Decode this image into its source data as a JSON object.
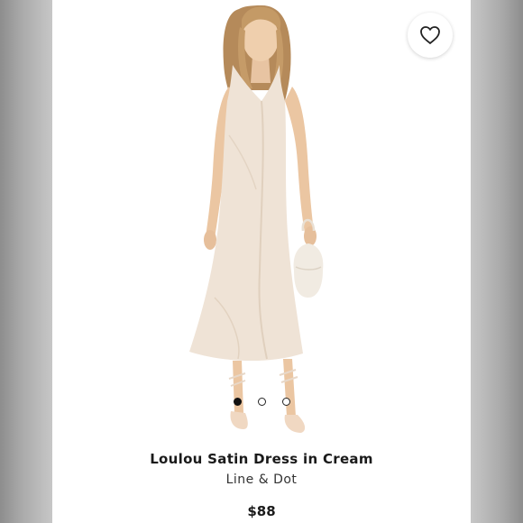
{
  "product": {
    "title": "Loulou Satin Dress in Cream",
    "brand": "Line & Dot",
    "price": "$88"
  },
  "favorite": {
    "icon": "heart-icon",
    "active": false
  },
  "carousel": {
    "slides": 3,
    "active_index": 0
  },
  "colors": {
    "dress": "#efe3d6",
    "background": "#ffffff",
    "frame": "#a9a9a9"
  }
}
